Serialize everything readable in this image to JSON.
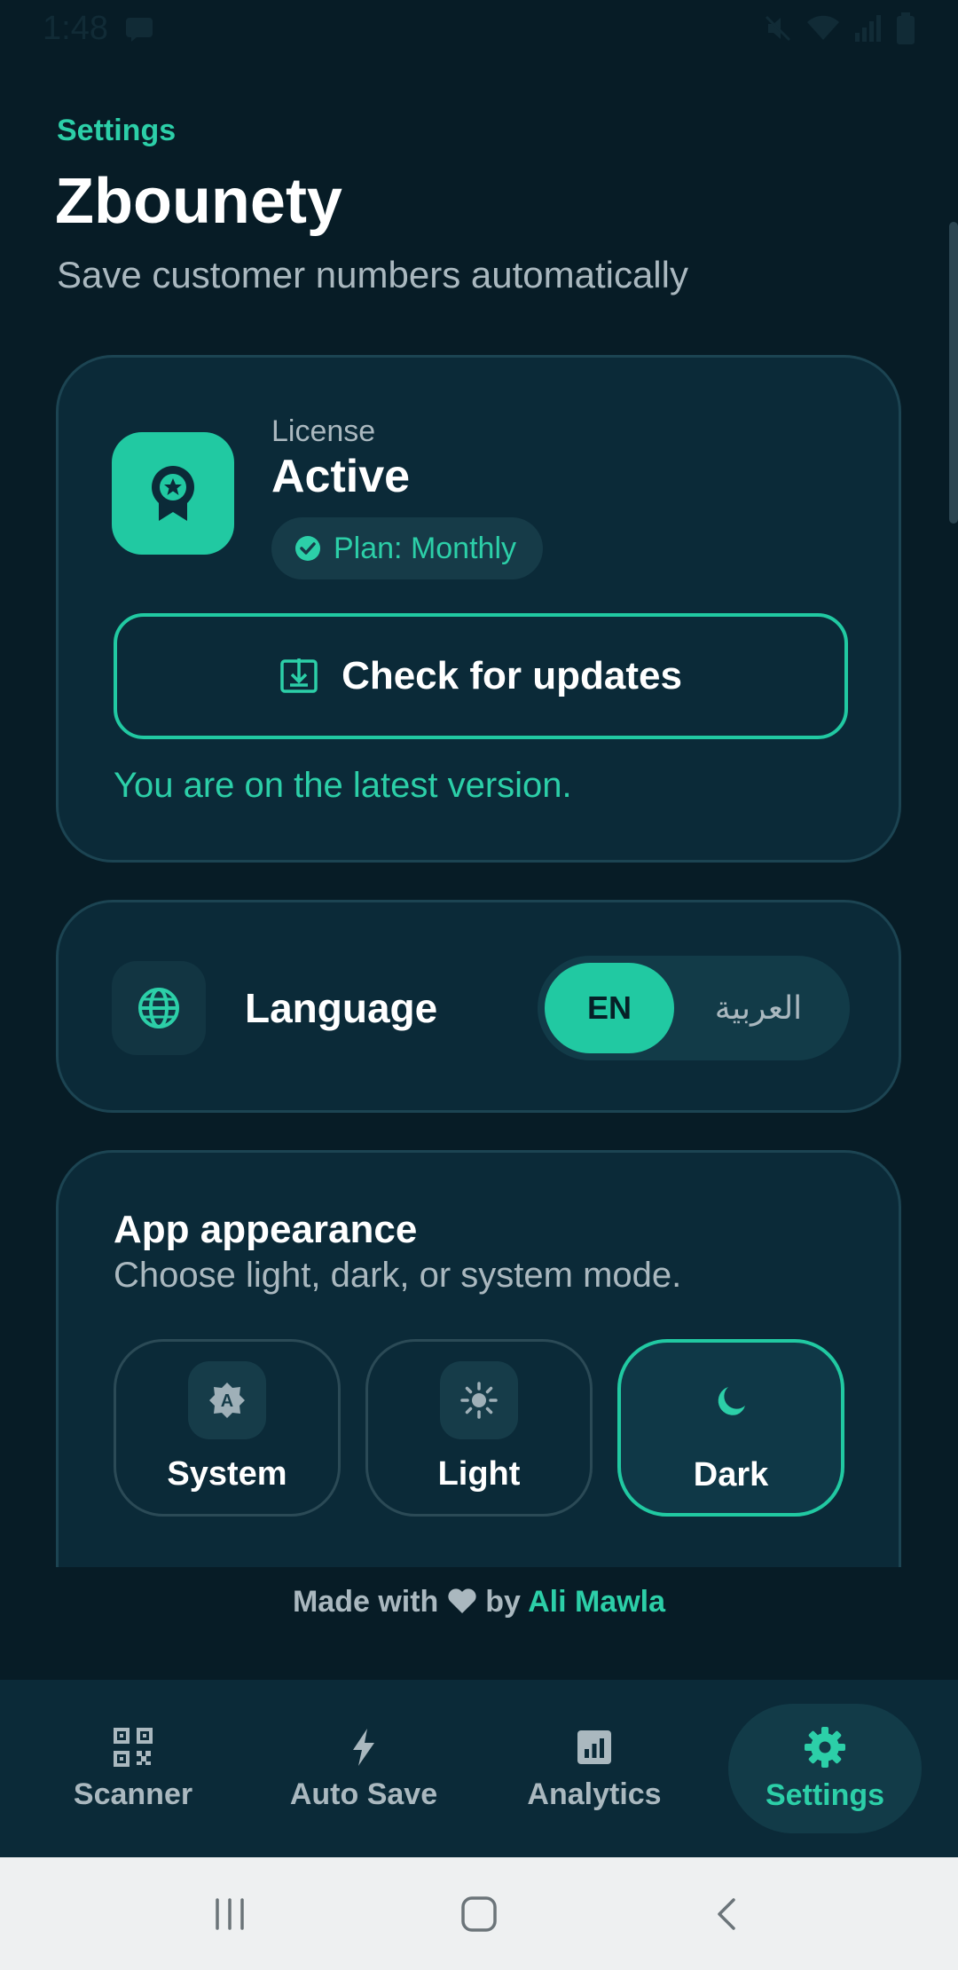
{
  "status_bar": {
    "time": "1:48"
  },
  "header": {
    "eyebrow": "Settings",
    "title": "Zbounety",
    "subtitle": "Save customer numbers automatically"
  },
  "license": {
    "label": "License",
    "status": "Active",
    "plan": "Plan: Monthly",
    "update_button": "Check for updates",
    "update_note": "You are on the latest version."
  },
  "language": {
    "label": "Language",
    "options": [
      {
        "label": "EN",
        "selected": true
      },
      {
        "label": "العربية",
        "selected": false
      }
    ]
  },
  "appearance": {
    "title": "App appearance",
    "subtitle": "Choose light, dark, or system mode.",
    "modes": [
      {
        "label": "System",
        "icon": "auto-mode-icon",
        "selected": false
      },
      {
        "label": "Light",
        "icon": "sun-icon",
        "selected": false
      },
      {
        "label": "Dark",
        "icon": "moon-icon",
        "selected": true
      }
    ]
  },
  "footer": {
    "prefix": "Made with",
    "by": "by",
    "author": "Ali Mawla"
  },
  "bottom_nav": [
    {
      "label": "Scanner",
      "icon": "qr-code-icon",
      "active": false
    },
    {
      "label": "Auto Save",
      "icon": "bolt-icon",
      "active": false
    },
    {
      "label": "Analytics",
      "icon": "chart-icon",
      "active": false
    },
    {
      "label": "Settings",
      "icon": "gear-icon",
      "active": true
    }
  ],
  "colors": {
    "background": "#071c26",
    "card": "#0b2a38",
    "accent": "#21c9a2",
    "muted_text": "#aab8bf"
  }
}
